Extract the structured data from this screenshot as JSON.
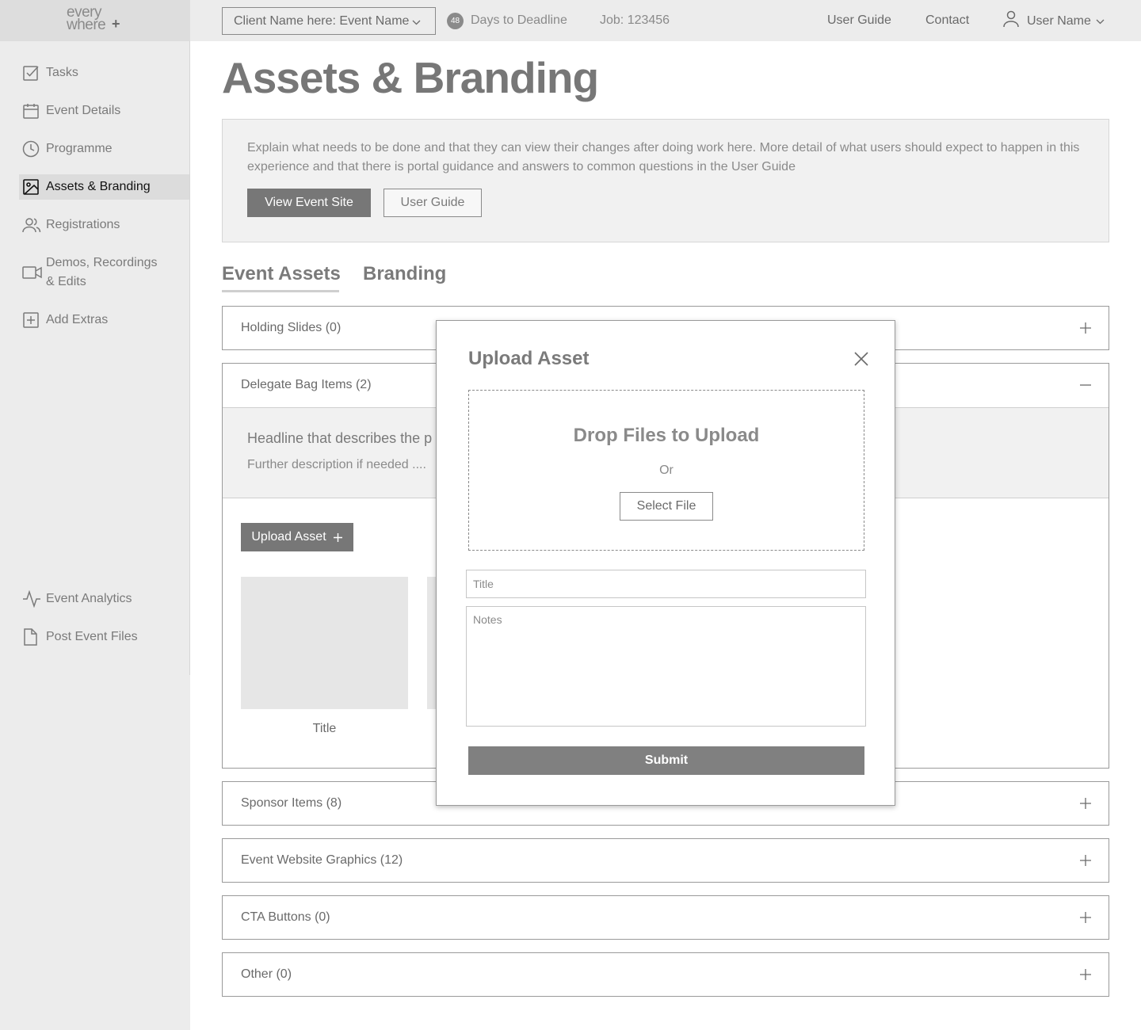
{
  "brand": {
    "logo_line1": "every",
    "logo_line2": "where",
    "logo_mark": "+"
  },
  "topbar": {
    "client_select": "Client Name here: Event Name",
    "days_count": "48",
    "days_label": "Days to Deadline",
    "job": "Job: 123456",
    "user_guide": "User Guide",
    "contact": "Contact",
    "user_name": "User Name"
  },
  "sidebar": {
    "items": [
      {
        "label": "Tasks",
        "icon": "checkbox-icon"
      },
      {
        "label": "Event Details",
        "icon": "calendar-icon"
      },
      {
        "label": "Programme",
        "icon": "clock-icon"
      },
      {
        "label": "Assets & Branding",
        "icon": "image-icon",
        "active": true
      },
      {
        "label": "Registrations",
        "icon": "users-icon"
      },
      {
        "label": "Demos, Recordings\n& Edits",
        "icon": "video-icon"
      },
      {
        "label": "Add Extras",
        "icon": "plus-square-icon"
      }
    ],
    "bottom_items": [
      {
        "label": "Event Analytics",
        "icon": "activity-icon"
      },
      {
        "label": "Post Event Files",
        "icon": "file-icon"
      }
    ]
  },
  "page": {
    "title": "Assets & Branding",
    "intro": "Explain what needs to be done and that they can view their changes after doing work here. More detail of what users should expect to happen in this experience and that there is portal guidance and answers to common questions in the User Guide",
    "view_event_site": "View Event Site",
    "user_guide_button": "User Guide"
  },
  "tabs": [
    {
      "label": "Event Assets",
      "active": true
    },
    {
      "label": "Branding",
      "active": false
    }
  ],
  "accordions": [
    {
      "label": "Holding Slides (0)",
      "expanded": false
    },
    {
      "label": "Delegate Bag Items (2)",
      "expanded": true
    },
    {
      "label": "Sponsor Items (8)",
      "expanded": false
    },
    {
      "label": "Event Website Graphics (12)",
      "expanded": false
    },
    {
      "label": "CTA Buttons (0)",
      "expanded": false
    },
    {
      "label": "Other (0)",
      "expanded": false
    }
  ],
  "expanded_section": {
    "headline": "Headline that describes the p",
    "description": "Further description if needed ....",
    "upload_button": "Upload Asset",
    "thumb_title": "Title"
  },
  "modal": {
    "title": "Upload Asset",
    "drop_title": "Drop Files to Upload",
    "or": "Or",
    "select_file": "Select File",
    "title_placeholder": "Title",
    "notes_placeholder": "Notes",
    "submit": "Submit"
  },
  "colors": {
    "sidebar_bg": "#ececec",
    "topbar_bg": "#ececec",
    "primary_button": "#777777",
    "active_nav": "#dcdcdc",
    "text": "#767676"
  }
}
